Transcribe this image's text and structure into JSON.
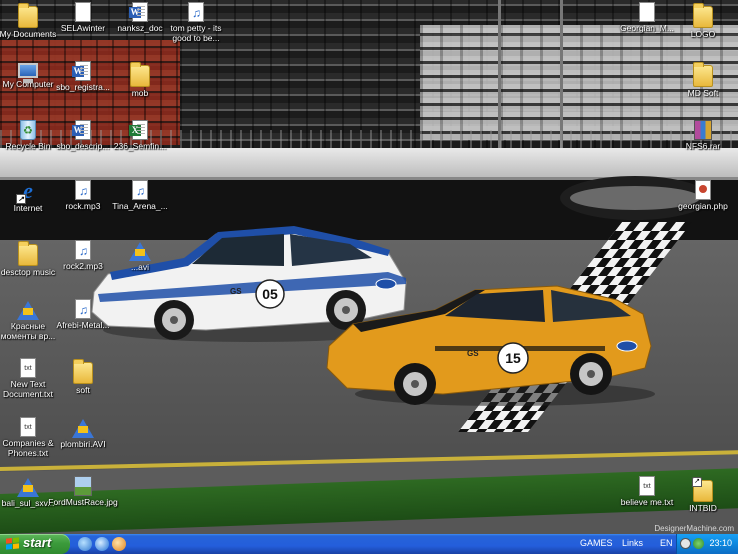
{
  "desktop": {
    "icons": [
      {
        "label": "My Documents",
        "icon": "folder-documents-icon"
      },
      {
        "label": "SELAwinter",
        "icon": "document-icon"
      },
      {
        "label": "nanksz_doc",
        "icon": "word-document-icon"
      },
      {
        "label": "tom petty - its good to be...",
        "icon": "mp3-icon"
      },
      {
        "label": "My Computer",
        "icon": "computer-icon"
      },
      {
        "label": "sbo_registra...",
        "icon": "word-document-icon"
      },
      {
        "label": "mob",
        "icon": "folder-icon"
      },
      {
        "label": "Recycle Bin",
        "icon": "recycle-bin-icon"
      },
      {
        "label": "sbo_descrip...",
        "icon": "word-document-icon"
      },
      {
        "label": "236_Semfin...",
        "icon": "excel-document-icon"
      },
      {
        "label": "Internet",
        "icon": "internet-explorer-icon"
      },
      {
        "label": "rock.mp3",
        "icon": "mp3-icon"
      },
      {
        "label": "Tina_Arena_...",
        "icon": "mp3-icon"
      },
      {
        "label": "desctop music",
        "icon": "folder-icon"
      },
      {
        "label": "rock2.mp3",
        "icon": "mp3-icon"
      },
      {
        "label": "...avi",
        "icon": "media-file-icon"
      },
      {
        "label": "Красные моменты вр...",
        "icon": "media-file-icon"
      },
      {
        "label": "Afrebi-Metal...",
        "icon": "mp3-icon"
      },
      {
        "label": "New Text Document.txt",
        "icon": "text-file-icon"
      },
      {
        "label": "soft",
        "icon": "folder-icon"
      },
      {
        "label": "Companies & Phones.txt",
        "icon": "text-file-icon"
      },
      {
        "label": "plombiri.AVI",
        "icon": "media-file-icon"
      },
      {
        "label": "bali_sul_sxv...",
        "icon": "media-file-icon"
      },
      {
        "label": "FordMustRace.jpg",
        "icon": "image-file-icon"
      },
      {
        "label": "Georgian_M...",
        "icon": "document-icon"
      },
      {
        "label": "LOGO",
        "icon": "folder-icon"
      },
      {
        "label": "MD Soft",
        "icon": "folder-icon"
      },
      {
        "label": "NFS6.rar",
        "icon": "archive-icon"
      },
      {
        "label": "georgian.php",
        "icon": "php-file-icon"
      },
      {
        "label": "believe me.txt",
        "icon": "text-file-icon"
      },
      {
        "label": "INTBID",
        "icon": "folder-icon"
      }
    ]
  },
  "wallpaper": {
    "watermark": "DesignerMachine.com",
    "car_white_number": "05",
    "car_orange_number": "15",
    "car_class": "GS"
  },
  "taskbar": {
    "start_label": "start",
    "quick_launch": [
      "show-desktop-icon",
      "internet-explorer-icon",
      "media-player-icon"
    ],
    "toolbar_games": "GAMES",
    "toolbar_links": "Links",
    "language": "EN",
    "clock": "23:10"
  },
  "colors": {
    "taskbar_blue": "#245edb",
    "start_green": "#3c9b3c",
    "tray_blue": "#0e8ae0",
    "car_white": "#f2f2f2",
    "car_stripe": "#1f4fa8",
    "car_orange": "#e29a1c"
  }
}
